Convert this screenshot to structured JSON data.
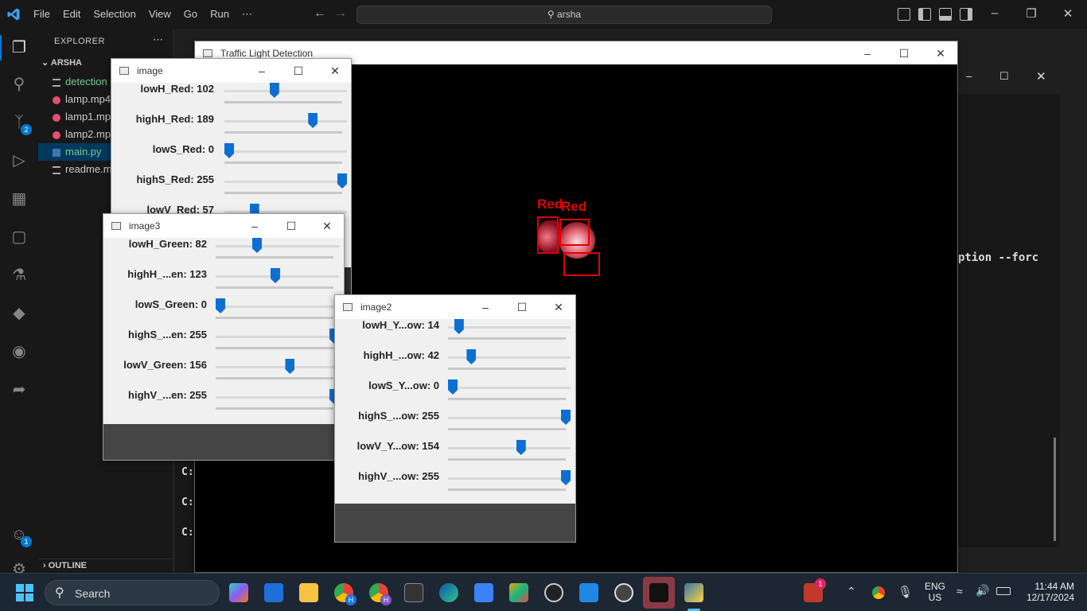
{
  "vscode": {
    "menu": [
      "File",
      "Edit",
      "Selection",
      "View",
      "Go",
      "Run",
      "⋯"
    ],
    "search": "arsha",
    "explorer_label": "EXPLORER",
    "folder": "ARSHA",
    "files": [
      "detection",
      "lamp.mp4",
      "lamp1.mp",
      "lamp2.mp",
      "main.py",
      "readme.m"
    ],
    "outline": "OUTLINE",
    "terminal_prompts": [
      "C:",
      "C:",
      "C:"
    ],
    "terminal_snippet": "ption --forc",
    "scm_badge": "2",
    "account_badge": "1"
  },
  "windows": {
    "traffic": {
      "title": "Traffic Light Detection",
      "labels": [
        "Red",
        "Red"
      ]
    },
    "image": {
      "title": "image",
      "trackbars": [
        {
          "label": "lowH_Red: 102",
          "value": 102,
          "max": 255
        },
        {
          "label": "highH_Red: 189",
          "value": 189,
          "max": 255
        },
        {
          "label": "lowS_Red: 0",
          "value": 0,
          "max": 255
        },
        {
          "label": "highS_Red: 255",
          "value": 255,
          "max": 255
        },
        {
          "label": "lowV_Red: 57",
          "value": 57,
          "max": 255
        }
      ]
    },
    "image3": {
      "title": "image3",
      "trackbars": [
        {
          "label": "lowH_Green: 82",
          "value": 82,
          "max": 255
        },
        {
          "label": "highH_...en: 123",
          "value": 123,
          "max": 255
        },
        {
          "label": "lowS_Green: 0",
          "value": 0,
          "max": 255
        },
        {
          "label": "highS_...en: 255",
          "value": 255,
          "max": 255
        },
        {
          "label": "lowV_Green: 156",
          "value": 156,
          "max": 255
        },
        {
          "label": "highV_...en: 255",
          "value": 255,
          "max": 255
        }
      ]
    },
    "image2": {
      "title": "image2",
      "trackbars": [
        {
          "label": "lowH_Y...ow: 14",
          "value": 14,
          "max": 255
        },
        {
          "label": "highH_...ow: 42",
          "value": 42,
          "max": 255
        },
        {
          "label": "lowS_Y...ow: 0",
          "value": 0,
          "max": 255
        },
        {
          "label": "highS_...ow: 255",
          "value": 255,
          "max": 255
        },
        {
          "label": "lowV_Y...ow: 154",
          "value": 154,
          "max": 255
        },
        {
          "label": "highV_...ow: 255",
          "value": 255,
          "max": 255
        }
      ]
    }
  },
  "taskbar": {
    "search": "Search",
    "lang": "ENG",
    "region": "US",
    "time": "11:44 AM",
    "date": "12/17/2024",
    "notif": "1",
    "chrome_badge_1": "H",
    "chrome_badge_2": "H"
  }
}
